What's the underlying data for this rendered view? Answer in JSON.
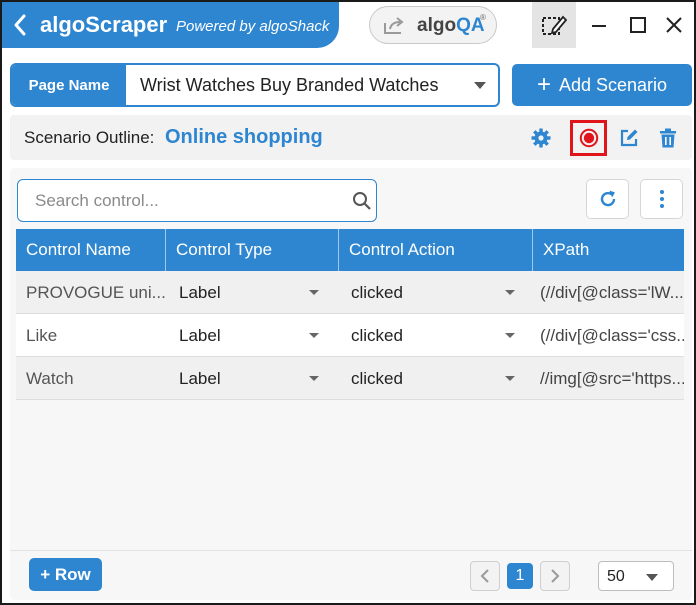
{
  "app": {
    "title": "algoScraper",
    "subtitle": "Powered by algoShack",
    "partner_brand_a": "algo",
    "partner_brand_b": "QA",
    "partner_brand_mark": "®"
  },
  "page_name": {
    "label": "Page Name",
    "value": "Wrist Watches Buy Branded Watches"
  },
  "add_scenario": {
    "label": "Add Scenario"
  },
  "scenario": {
    "label": "Scenario Outline:",
    "name": "Online shopping"
  },
  "search": {
    "placeholder": "Search control..."
  },
  "table": {
    "columns": [
      "Control Name",
      "Control Type",
      "Control Action",
      "XPath"
    ],
    "rows": [
      {
        "name": "PROVOGUE uni...",
        "type": "Label",
        "action": "clicked",
        "xpath": "(//div[@class='lW..."
      },
      {
        "name": "Like",
        "type": "Label",
        "action": "clicked",
        "xpath": "(//div[@class='css..."
      },
      {
        "name": "Watch",
        "type": "Label",
        "action": "clicked",
        "xpath": "//img[@src='https..."
      }
    ]
  },
  "footer": {
    "add_row": "+ Row",
    "current_page": "1",
    "page_size": "50"
  },
  "colors": {
    "accent": "#2e86d0",
    "record_highlight": "#e0141b"
  },
  "icons": [
    "chevron-left-icon",
    "share-icon",
    "select-area-icon",
    "minimize-icon",
    "maximize-icon",
    "close-icon",
    "gear-icon",
    "record-icon",
    "edit-icon",
    "trash-icon",
    "search-icon",
    "refresh-icon",
    "kebab-menu-icon"
  ]
}
